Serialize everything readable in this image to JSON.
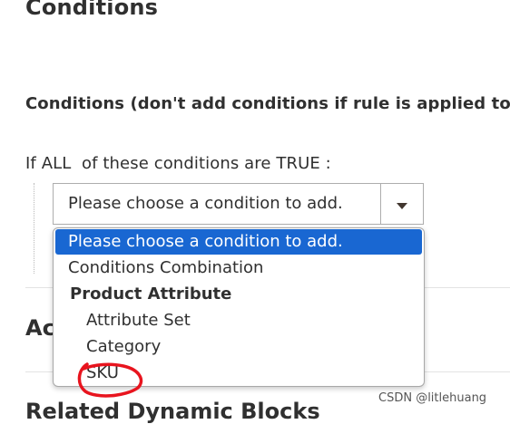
{
  "page": {
    "heading": "Conditions",
    "fieldset_legend": "Conditions (don't add conditions if rule is applied to",
    "rule_sentence": {
      "prefix": "If",
      "aggregator": "ALL",
      "middle": "of these conditions are",
      "value": "TRUE",
      "suffix": ":"
    }
  },
  "condition_select": {
    "selected_label": "Please choose a condition to add.",
    "arrow_icon": "chevron-down-icon"
  },
  "dropdown": {
    "options": [
      {
        "label": "Please choose a condition to add.",
        "selected": true
      },
      {
        "label": "Conditions Combination"
      }
    ],
    "group_label": "Product Attribute",
    "group_options": [
      {
        "label": "Attribute Set"
      },
      {
        "label": "Category"
      },
      {
        "label": "SKU"
      }
    ]
  },
  "sections": {
    "actions_title": "Ac",
    "related_title": "Related Dynamic Blocks"
  },
  "watermark": "CSDN @litlehuang",
  "colors": {
    "selected_option_bg": "#1967d2",
    "annotation_circle": "#e8141e",
    "text": "#303030"
  }
}
